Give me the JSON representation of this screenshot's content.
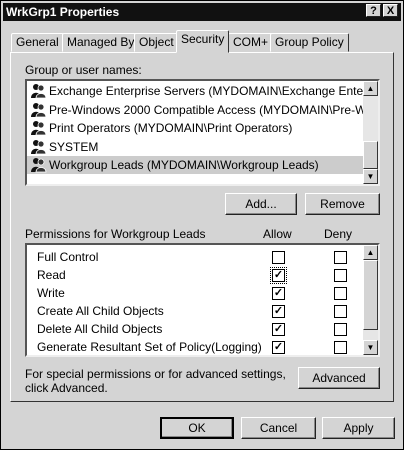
{
  "window": {
    "title": "WrkGrp1 Properties",
    "help_label": "?",
    "close_label": "X"
  },
  "tabs": [
    {
      "label": "General"
    },
    {
      "label": "Managed By"
    },
    {
      "label": "Object"
    },
    {
      "label": "Security"
    },
    {
      "label": "COM+"
    },
    {
      "label": "Group Policy"
    }
  ],
  "active_tab": "Security",
  "groups": {
    "label": "Group or user names:",
    "items": [
      {
        "name": "Exchange Enterprise Servers (MYDOMAIN\\Exchange Enterpris..."
      },
      {
        "name": "Pre-Windows 2000 Compatible Access (MYDOMAIN\\Pre-Wind..."
      },
      {
        "name": "Print Operators (MYDOMAIN\\Print Operators)"
      },
      {
        "name": "SYSTEM"
      },
      {
        "name": "Workgroup Leads (MYDOMAIN\\Workgroup Leads)"
      }
    ],
    "selected": "Workgroup Leads (MYDOMAIN\\Workgroup Leads)",
    "add_label": "Add...",
    "remove_label": "Remove"
  },
  "permissions": {
    "label": "Permissions for Workgroup Leads",
    "allow_header": "Allow",
    "deny_header": "Deny",
    "rows": [
      {
        "name": "Full Control",
        "allow": false,
        "deny": false
      },
      {
        "name": "Read",
        "allow": true,
        "deny": false
      },
      {
        "name": "Write",
        "allow": true,
        "deny": false
      },
      {
        "name": "Create All Child Objects",
        "allow": true,
        "deny": false
      },
      {
        "name": "Delete All Child Objects",
        "allow": true,
        "deny": false
      },
      {
        "name": "Generate Resultant Set of Policy(Logging)",
        "allow": true,
        "deny": false
      }
    ]
  },
  "advanced": {
    "text_line1": "For special permissions or for advanced settings,",
    "text_line2": "click Advanced.",
    "button_label": "Advanced"
  },
  "footer": {
    "ok_label": "OK",
    "cancel_label": "Cancel",
    "apply_label": "Apply"
  }
}
